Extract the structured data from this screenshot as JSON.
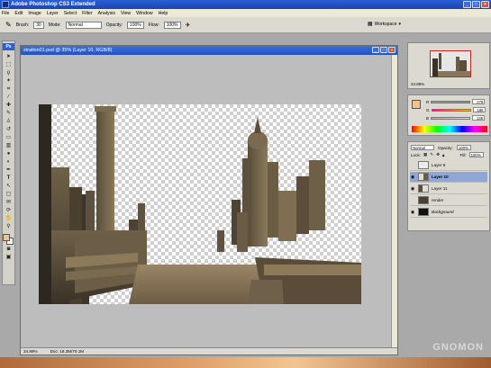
{
  "app": {
    "title": "Adobe Photoshop CS3 Extended"
  },
  "menu": [
    "File",
    "Edit",
    "Image",
    "Layer",
    "Select",
    "Filter",
    "Analysis",
    "View",
    "Window",
    "Help"
  ],
  "options": {
    "brush_label": "Brush:",
    "brush_size": "30",
    "mode_label": "Mode:",
    "mode_value": "Normal",
    "opacity_label": "Opacity:",
    "opacity_value": "100%",
    "flow_label": "Flow:",
    "flow_value": "100%",
    "workspace_label": "Workspace"
  },
  "toolbar": {
    "ps_badge": "Ps"
  },
  "document": {
    "title": "stration01.psd @ 35% (Layer 10, RGB/8)",
    "zoom": "34.89%",
    "doc_info": "Doc: 18.2M/70.1M"
  },
  "navigator": {
    "zoom": "34.89%"
  },
  "color": {
    "r": "279",
    "g": "186",
    "b": "148"
  },
  "layers": {
    "blend_mode": "Normal",
    "opacity_label": "Opacity:",
    "opacity_value": "100%",
    "lock_label": "Lock:",
    "fill_label": "Fill:",
    "fill_value": "100%",
    "items": [
      {
        "name": "Layer 9",
        "visible": false,
        "active": false
      },
      {
        "name": "Layer 10",
        "visible": true,
        "active": true
      },
      {
        "name": "Layer 11",
        "visible": true,
        "active": false
      },
      {
        "name": "render",
        "visible": false,
        "active": false
      },
      {
        "name": "Background",
        "visible": true,
        "active": false
      }
    ]
  },
  "watermark": "GNOMON",
  "colors": {
    "title_blue": "#2a5fd6",
    "fg_swatch": "#f6c08c",
    "active_layer": "#8fa7d6"
  }
}
